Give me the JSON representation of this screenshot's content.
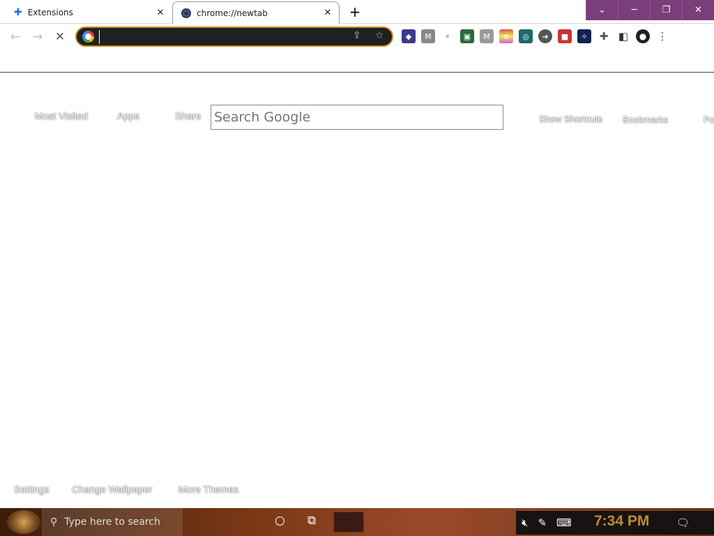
{
  "tabs": [
    {
      "label": "Extensions",
      "icon": "puzzle-icon"
    },
    {
      "label": "chrome://newtab",
      "icon": "chrome-theme-icon"
    }
  ],
  "omnibox": {
    "value": "",
    "placeholder": ""
  },
  "extensions": [
    "ext-1",
    "ext-2",
    "ext-3",
    "ext-4",
    "ext-5",
    "ext-6",
    "ext-7",
    "ext-8",
    "ext-9",
    "ext-10"
  ],
  "newtab": {
    "left_links": [
      "Most Visited",
      "Apps",
      "Share"
    ],
    "right_links": [
      "Show Shortcuts",
      "Bookmarks",
      "Po"
    ],
    "search_placeholder": "Search Google",
    "bottom_links": [
      "Settings",
      "Change Wallpaper",
      "More Themes"
    ]
  },
  "taskbar": {
    "search_placeholder": "Type here to search",
    "time": "7:34 PM"
  },
  "colors": {
    "window_controls": "#7a3f7a",
    "omnibox_border": "#c98a1a",
    "clock": "#c08a3a"
  }
}
